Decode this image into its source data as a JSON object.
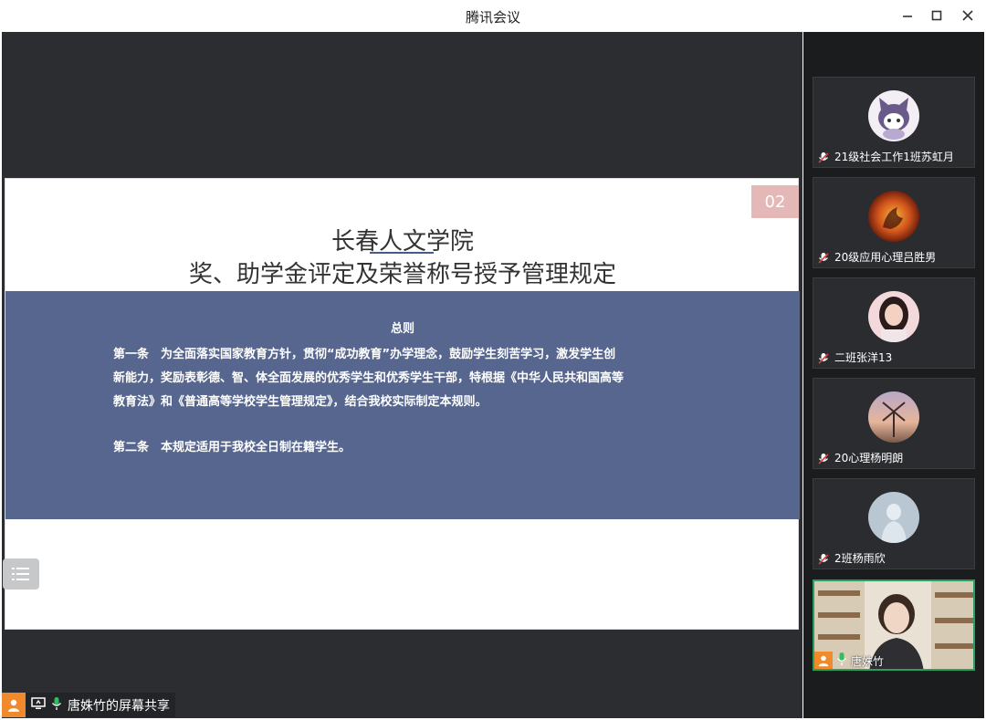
{
  "window": {
    "title": "腾讯会议",
    "minimize_icon": "minimize-icon",
    "maximize_icon": "maximize-icon",
    "close_icon": "close-icon"
  },
  "slide": {
    "number": "02",
    "title_line1": "长春人文学院",
    "title_line2": "奖、助学金评定及荣誉称号授予管理规定",
    "panel_heading": "总则",
    "article1_line1": "第一条　为全面落实国家教育方针，贯彻“成功教育”办学理念，鼓励学生刻苦学习，激发学生创",
    "article1_line2": "新能力，奖励表彰德、智、体全面发展的优秀学生和优秀学生干部，特根据《中华人民共和国高等",
    "article1_line3": "教育法》和《普通高等学校学生管理规定》，结合我校实际制定本规则。",
    "article2": "第二条　本规定适用于我校全日制在籍学生。",
    "accent_color": "#56668f",
    "number_bg_color": "#e3b8b6"
  },
  "share_bar": {
    "label": "唐姝竹的屏幕共享",
    "user_icon": "user-icon",
    "screen_icon": "screen-share-icon",
    "mic_icon": "mic-icon"
  },
  "participants": [
    {
      "name": "21级社会工作1班苏虹月",
      "mic": "muted",
      "avatar": "cartoon-avatar"
    },
    {
      "name": "20级应用心理吕胜男",
      "mic": "muted",
      "avatar": "fire-avatar"
    },
    {
      "name": "二班张洋13",
      "mic": "muted",
      "avatar": "girl-avatar"
    },
    {
      "name": "20心理杨明朗",
      "mic": "muted",
      "avatar": "windmill-avatar"
    },
    {
      "name": "2班杨雨欣",
      "mic": "muted",
      "avatar": "statue-avatar"
    }
  ],
  "self_view": {
    "name": "唐姝竹",
    "mic": "active",
    "border_color": "#28a060"
  }
}
